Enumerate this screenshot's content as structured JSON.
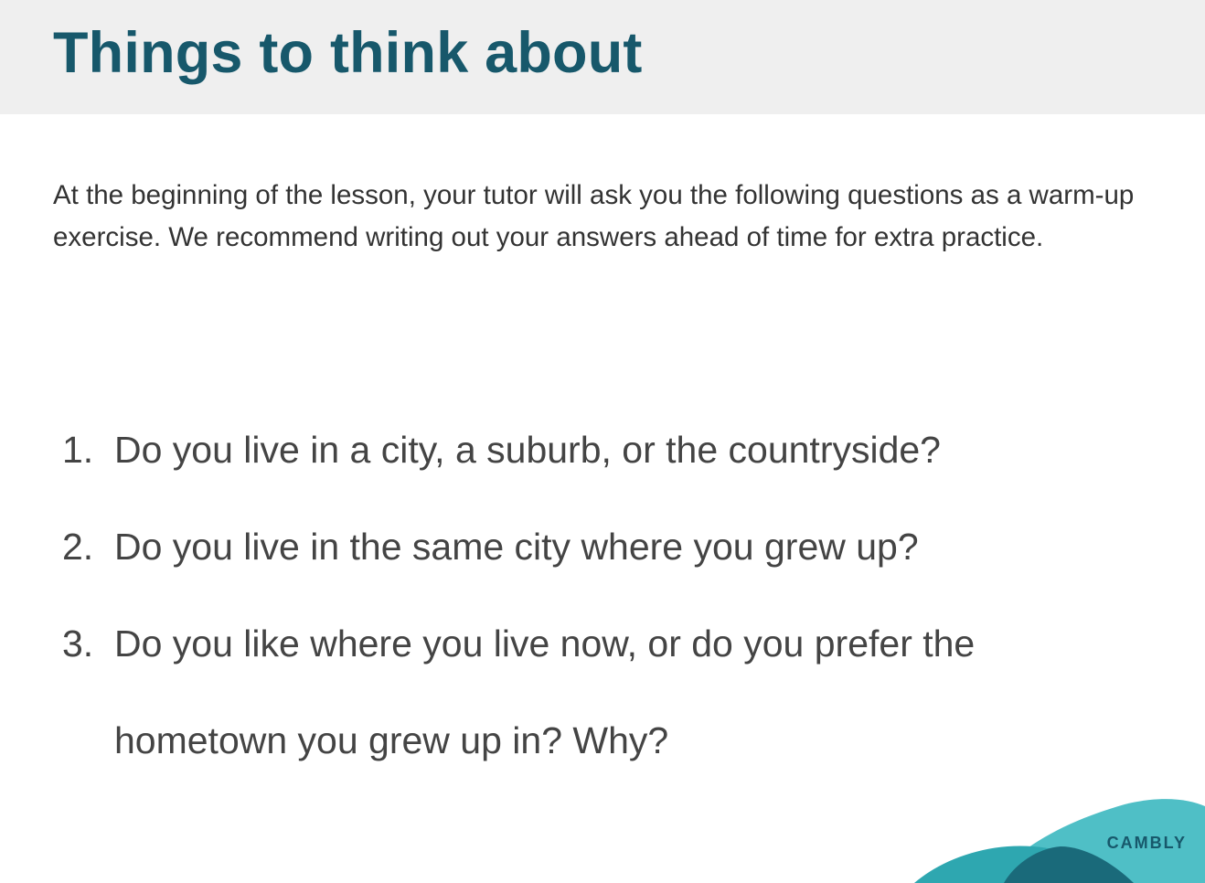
{
  "header": {
    "title": "Things to think about"
  },
  "intro": {
    "text": "At the beginning of the lesson, your tutor will ask you the following questions as a warm-up exercise. We recommend writing out your answers ahead of time for extra practice."
  },
  "questions": [
    {
      "number": "1.",
      "text": "Do you live in a city, a suburb, or the countryside?"
    },
    {
      "number": "2.",
      "text": "Do you live in the same city where you grew up?"
    },
    {
      "number": "3.",
      "text": "Do you like where you live now, or do you prefer the hometown you grew up in? Why?"
    }
  ],
  "brand": {
    "logo_text": "CAMBLY",
    "colors": {
      "title": "#17586b",
      "wave_light": "#4fbfc6",
      "wave_mid": "#2ea7b0",
      "wave_dark": "#1a6a7a",
      "header_bg": "#efefef"
    }
  }
}
